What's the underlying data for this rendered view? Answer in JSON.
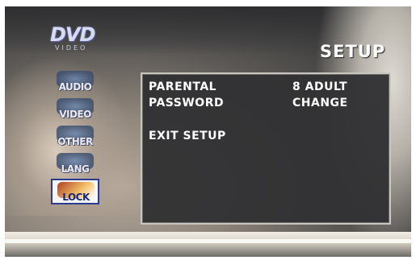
{
  "logo": {
    "main": "DVD",
    "sub": "VIDEO"
  },
  "title": "SETUP",
  "sidebar": {
    "items": [
      {
        "label": "AUDIO"
      },
      {
        "label": "VIDEO"
      },
      {
        "label": "OTHER"
      },
      {
        "label": "LANG"
      },
      {
        "label": "LOCK"
      }
    ],
    "active": "LOCK"
  },
  "panel": {
    "rows": [
      {
        "label": "PARENTAL",
        "value": "8 ADULT"
      },
      {
        "label": "PASSWORD",
        "value": "CHANGE"
      }
    ],
    "exit_label": "EXIT SETUP"
  },
  "colors": {
    "panel_bg": "#323234",
    "text": "#ffffff",
    "active_border": "#2d3b8e"
  }
}
